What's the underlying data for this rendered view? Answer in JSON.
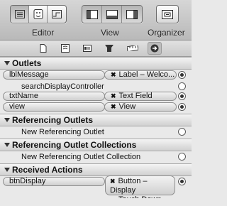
{
  "toolbar": {
    "editor_label": "Editor",
    "view_label": "View",
    "organizer_label": "Organizer"
  },
  "inspector_tabs": [
    "file-icon",
    "quick-help-icon",
    "identity-icon",
    "attributes-icon",
    "size-icon",
    "connections-icon"
  ],
  "sections": {
    "outlets": {
      "title": "Outlets",
      "rows": [
        {
          "name": "lblMessage",
          "target": "Label – Welco...",
          "connected": true
        },
        {
          "name": "searchDisplayController",
          "target": "",
          "connected": false
        },
        {
          "name": "txtName",
          "target": "Text Field",
          "connected": true
        },
        {
          "name": "view",
          "target": "View",
          "connected": true
        }
      ]
    },
    "referencing_outlets": {
      "title": "Referencing Outlets",
      "rows": [
        {
          "name": "New Referencing Outlet"
        }
      ]
    },
    "referencing_outlet_collections": {
      "title": "Referencing Outlet Collections",
      "rows": [
        {
          "name": "New Referencing Outlet Collection"
        }
      ]
    },
    "received_actions": {
      "title": "Received Actions",
      "rows": [
        {
          "name": "btnDisplay",
          "target_line1": "Button – Display",
          "target_line2": "Touch Down",
          "connected": true
        }
      ]
    }
  }
}
